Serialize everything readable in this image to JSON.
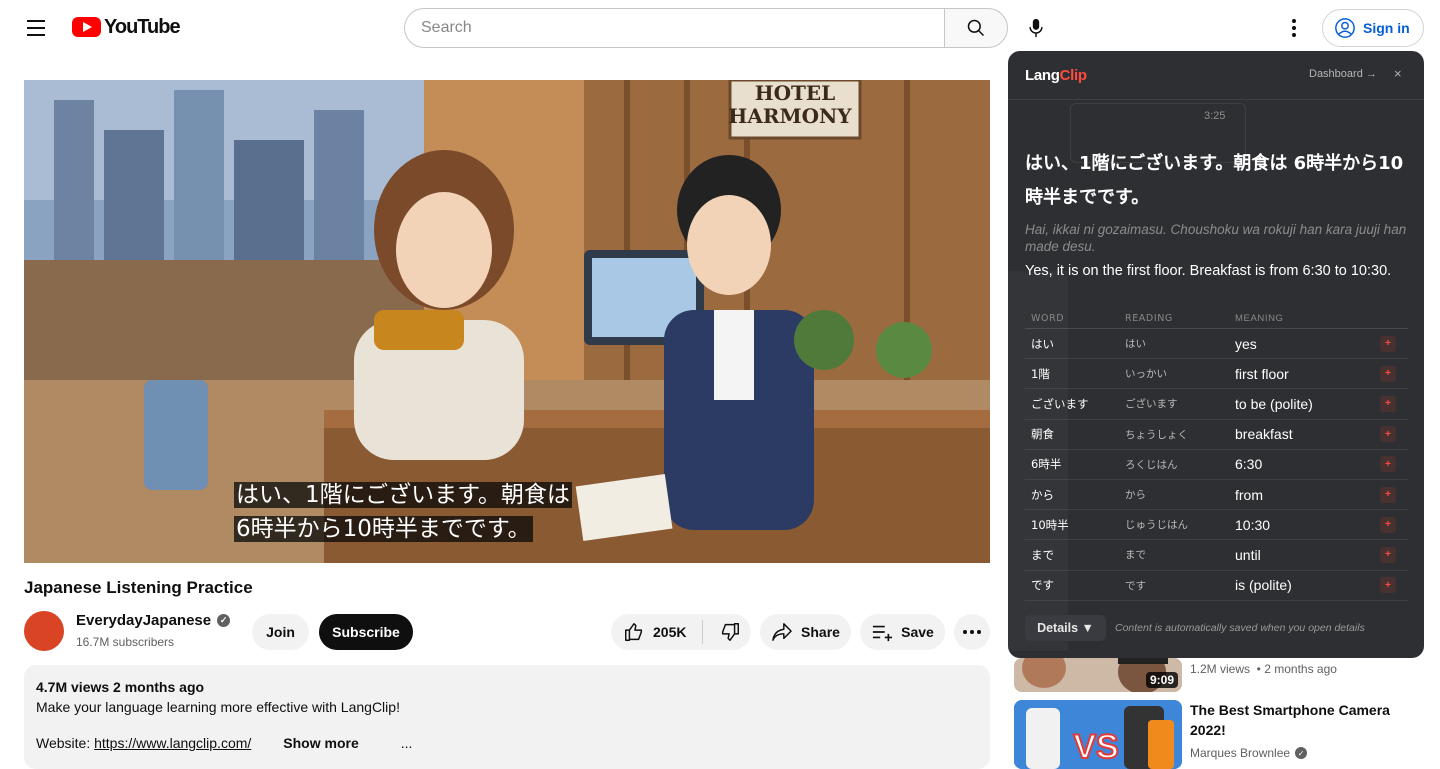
{
  "header": {
    "logo_text": "YouTube",
    "search_placeholder": "Search",
    "sign_in_label": "Sign in"
  },
  "video": {
    "poster_sign": [
      "HOTEL",
      "HARMONY"
    ],
    "caption_lines": [
      "はい、1階にございます。朝食は",
      "6時半から10時半までです。"
    ],
    "title": "Japanese Listening Practice"
  },
  "channel": {
    "name": "EverydayJapanese",
    "subscribers": "16.7M subscribers",
    "join_label": "Join",
    "subscribe_label": "Subscribe"
  },
  "actions": {
    "likes": "205K",
    "share_label": "Share",
    "save_label": "Save"
  },
  "description": {
    "meta": "4.7M views  2 months ago",
    "text": "Make your language learning more effective with LangClip!",
    "website_label": "Website: ",
    "website_link": "https://www.langclip.com/",
    "show_more": "Show more",
    "ellipsis": "..."
  },
  "recommendations": [
    {
      "meta": "1.2M views  • 2 months ago",
      "duration": "9:09"
    },
    {
      "title_1": "The Best Smartphone Camera",
      "title_2": "2022!",
      "channel": "Marques Brownlee",
      "vs_text": "VS"
    }
  ],
  "langclip": {
    "logo_lang": "Lang",
    "logo_clip": "Clip",
    "dashboard_label": "Dashboard →",
    "close_label": "×",
    "timestamp": "3:25",
    "jp_sentence": "はい、1階にございます。朝食は 6時半から10時半までです。",
    "romaji": "Hai, ikkai ni gozaimasu. Choushoku wa rokuji han kara juuji han made desu.",
    "english": "Yes, it is on the first floor. Breakfast is from 6:30 to 10:30.",
    "columns": {
      "word": "WORD",
      "reading": "READING",
      "meaning": "MEANING"
    },
    "words": [
      {
        "word": "はい",
        "reading": "はい",
        "meaning": "yes"
      },
      {
        "word": "1階",
        "reading": "いっかい",
        "meaning": "first floor"
      },
      {
        "word": "ございます",
        "reading": "ございます",
        "meaning": "to be (polite)"
      },
      {
        "word": "朝食",
        "reading": "ちょうしょく",
        "meaning": "breakfast"
      },
      {
        "word": "6時半",
        "reading": "ろくじはん",
        "meaning": "6:30"
      },
      {
        "word": "から",
        "reading": "から",
        "meaning": "from"
      },
      {
        "word": "10時半",
        "reading": "じゅうじはん",
        "meaning": "10:30"
      },
      {
        "word": "まで",
        "reading": "まで",
        "meaning": "until"
      },
      {
        "word": "です",
        "reading": "です",
        "meaning": "is (polite)"
      }
    ],
    "add_symbol": "+",
    "details_label": "Details ▼",
    "auto_save_note": "Content is automatically saved when you open details"
  },
  "colors": {
    "brand_red": "#ff0000",
    "link_blue": "#065fd4",
    "langclip_accent": "#ff4a3d"
  }
}
